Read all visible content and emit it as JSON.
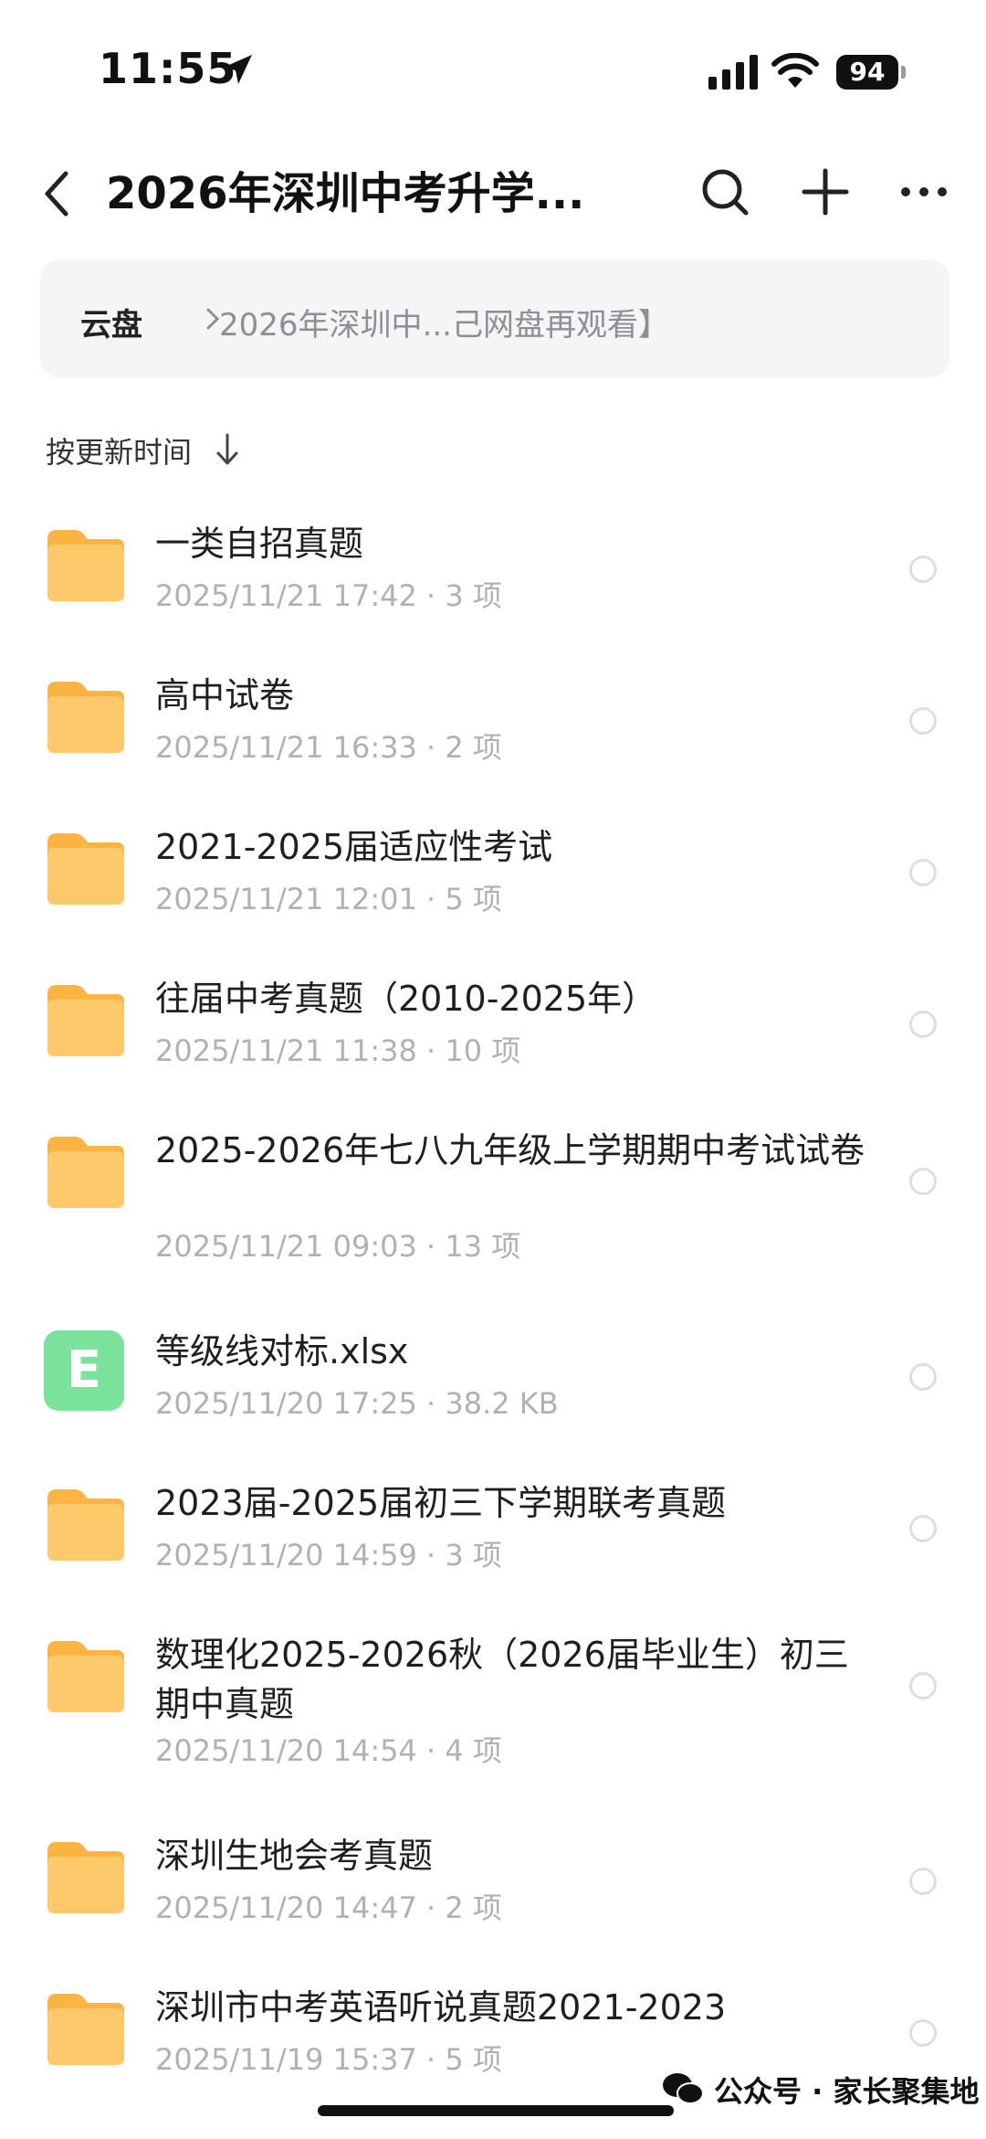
{
  "status_bar": {
    "time": "11:55",
    "battery": "94"
  },
  "header": {
    "title": "2026年深圳中考升学..."
  },
  "breadcrumb": {
    "root": "云盘",
    "current": "2026年深圳中...己网盘再观看】"
  },
  "sort": {
    "label": "按更新时间"
  },
  "items": [
    {
      "type": "folder",
      "name": "一类自招真题",
      "meta": "2025/11/21 17:42 · 3 项"
    },
    {
      "type": "folder",
      "name": "高中试卷",
      "meta": "2025/11/21 16:33 · 2 项"
    },
    {
      "type": "folder",
      "name": "2021-2025届适应性考试",
      "meta": "2025/11/21 12:01 · 5 项"
    },
    {
      "type": "folder",
      "name": "往届中考真题（2010-2025年）",
      "meta": "2025/11/21 11:38 · 10 项"
    },
    {
      "type": "folder",
      "name": "2025-2026年七八九年级上学期期中考试试卷",
      "meta": "2025/11/21 09:03 · 13 项"
    },
    {
      "type": "excel",
      "icon_letter": "E",
      "name": "等级线对标.xlsx",
      "meta": "2025/11/20 17:25 · 38.2 KB"
    },
    {
      "type": "folder",
      "name": "2023届-2025届初三下学期联考真题",
      "meta": "2025/11/20 14:59 · 3 项"
    },
    {
      "type": "folder",
      "name": "数理化2025-2026秋（2026届毕业生）初三期中真题",
      "meta": "2025/11/20 14:54 · 4 项"
    },
    {
      "type": "folder",
      "name": "深圳生地会考真题",
      "meta": "2025/11/20 14:47 · 2 项"
    },
    {
      "type": "folder",
      "name": "深圳市中考英语听说真题2021-2023",
      "meta": "2025/11/19 15:37 · 5 项"
    }
  ],
  "watermark": {
    "text": "公众号 · 家长聚集地"
  },
  "colors": {
    "folder": "#fdc05a",
    "excel": "#7be29b",
    "meta": "#b0b0b5"
  }
}
